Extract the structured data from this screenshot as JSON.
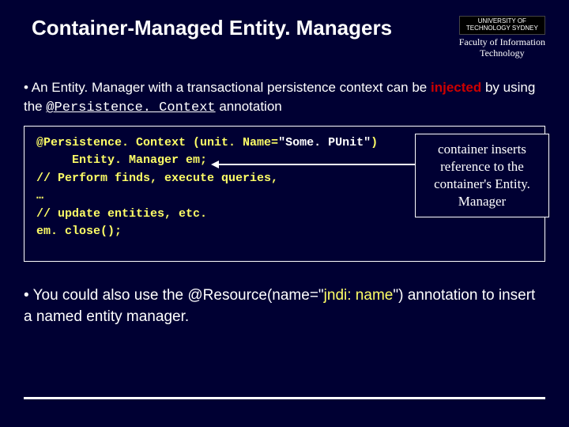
{
  "header": {
    "title": "Container-Managed Entity. Managers",
    "logo_line1": "UNIVERSITY OF",
    "logo_line2": "TECHNOLOGY SYDNEY",
    "faculty_line1": "Faculty of Information",
    "faculty_line2": "Technology"
  },
  "bullet1": {
    "pre": "• An Entity. Manager with a transactional persistence context can be ",
    "injected": "injected",
    "mid": " by using the ",
    "anno": "@Persistence. Context",
    "post": " annotation"
  },
  "code": {
    "line1a": "@Persistence. Context (unit. Name=",
    "line1b": "\"Some. PUnit\"",
    "line1c": ")",
    "line2": "     Entity. Manager em;",
    "line3": "// Perform finds, execute queries,",
    "line4": "…",
    "line5": "// update entities, etc.",
    "line6": "em. close();"
  },
  "callout": "container  inserts reference to the container's Entity. Manager",
  "bullet2": {
    "pre": "• You could also use the @Resource(name=\"",
    "jndi": "jndi: name",
    "post": "\") annotation to insert a named entity manager."
  }
}
